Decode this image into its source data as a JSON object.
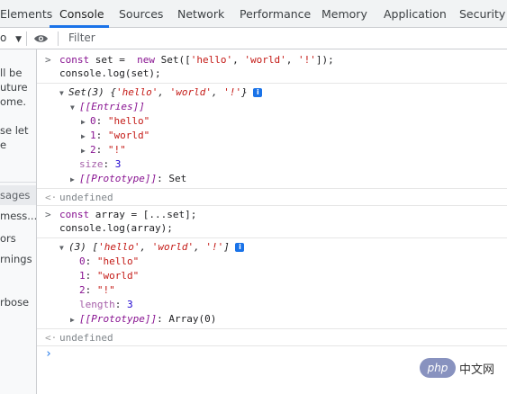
{
  "tabs": [
    "Elements",
    "Console",
    "Sources",
    "Network",
    "Performance",
    "Memory",
    "Application",
    "Security"
  ],
  "active_tab": "Console",
  "toolbar": {
    "context": "o",
    "filter_placeholder": "Filter"
  },
  "sidebar": {
    "lines": [
      "ll be",
      "uture",
      "ome.",
      "se let",
      "e"
    ],
    "selected": "sages",
    "items": [
      "mess...",
      "ors",
      "rnings",
      "rbose"
    ]
  },
  "console": {
    "input1": [
      "const set =  new Set(['hello', 'world', '!']);",
      "console.log(set);"
    ],
    "set_header": "Set(3) {'hello', 'world', '!'}",
    "entries_label": "[[Entries]]",
    "entries": [
      {
        "index": "0",
        "value": "\"hello\""
      },
      {
        "index": "1",
        "value": "\"world\""
      },
      {
        "index": "2",
        "value": "\"!\""
      }
    ],
    "size_key": "size",
    "size_value": "3",
    "proto1_key": "[[Prototype]]",
    "proto1_value": "Set",
    "undefined1": "undefined",
    "input2": [
      "const array = [...set];",
      "console.log(array);"
    ],
    "array_header": "(3) ['hello', 'world', '!']",
    "array_items": [
      {
        "index": "0",
        "value": "\"hello\""
      },
      {
        "index": "1",
        "value": "\"world\""
      },
      {
        "index": "2",
        "value": "\"!\""
      }
    ],
    "length_key": "length",
    "length_value": "3",
    "proto2_key": "[[Prototype]]",
    "proto2_value": "Array(0)",
    "undefined2": "undefined"
  },
  "watermark": {
    "badge": "php",
    "text": "中文网"
  },
  "colors": {
    "accent": "#1a73e8",
    "keyword": "#881391",
    "string": "#c41a16",
    "number": "#1c00cf"
  },
  "icons": [
    "chevron-right-icon",
    "eye-icon",
    "info-icon",
    "triangle-down-icon",
    "triangle-right-icon",
    "return-arrow-icon"
  ]
}
